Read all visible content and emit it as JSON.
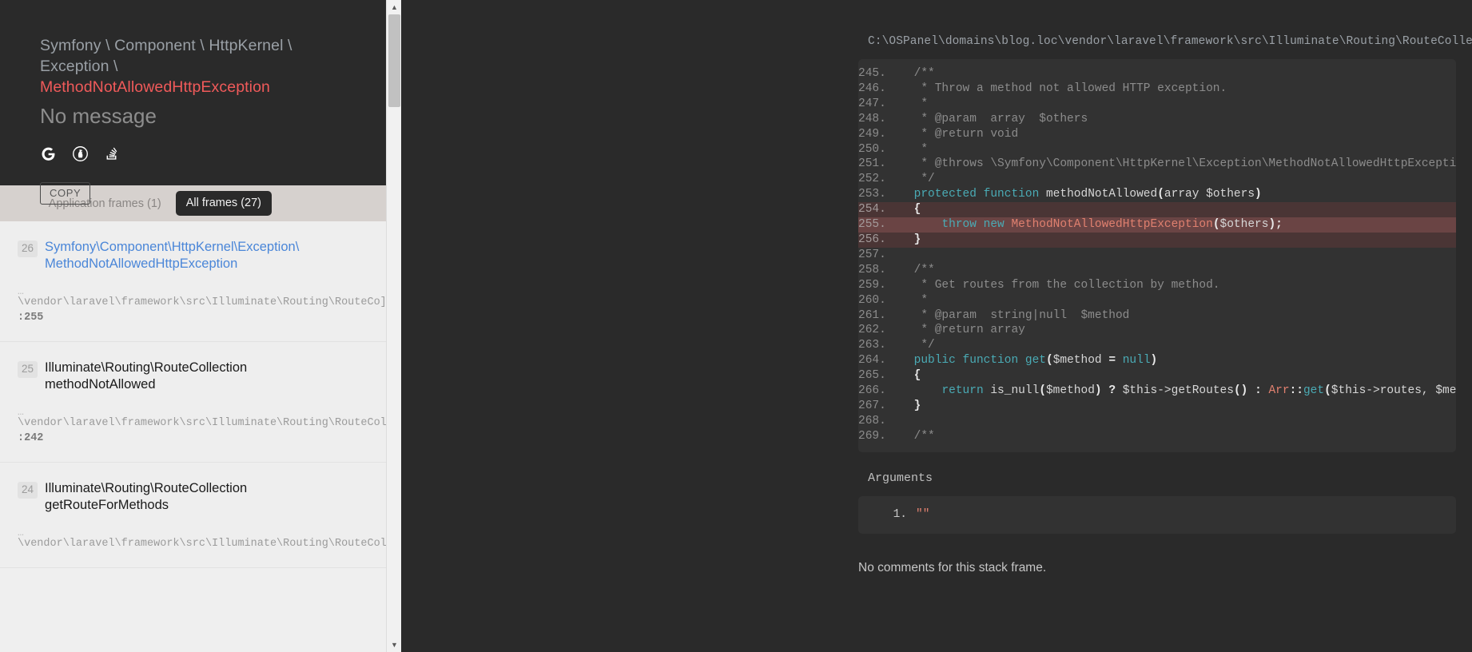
{
  "exception": {
    "namespace": "Symfony \\ Component \\ HttpKernel \\ Exception \\",
    "class_short": "MethodNotAllowedHttpException",
    "message": "No message",
    "copy_label": "COPY",
    "icons": [
      {
        "name": "google-search-icon",
        "glyph": "G"
      },
      {
        "name": "duckduckgo-search-icon",
        "glyph": "D"
      },
      {
        "name": "stackoverflow-search-icon",
        "glyph": "S"
      }
    ]
  },
  "frames_tabs": [
    {
      "label": "Application frames (1)",
      "active": false,
      "name": "tab-application-frames"
    },
    {
      "label": "All frames (27)",
      "active": true,
      "name": "tab-all-frames"
    }
  ],
  "frames": [
    {
      "number": "26",
      "class": "Symfony\\Component\\HttpKernel\\Exception\\",
      "method": "MethodNotAllowedHttpException",
      "path": "\\vendor\\laravel\\framework\\src\\Illuminate\\Routing\\RouteCo]",
      "line": ":255",
      "selected": true
    },
    {
      "number": "25",
      "class": "Illuminate\\Routing\\RouteCollection",
      "method": "methodNotAllowed",
      "path": "\\vendor\\laravel\\framework\\src\\Illuminate\\Routing\\RouteCol",
      "line": ":242",
      "selected": false
    },
    {
      "number": "24",
      "class": "Illuminate\\Routing\\RouteCollection",
      "method": "getRouteForMethods",
      "path": "\\vendor\\laravel\\framework\\src\\Illuminate\\Routing\\RouteCol",
      "line": "",
      "selected": false
    }
  ],
  "editor": {
    "file_path": "C:\\OSPanel\\domains\\blog.loc\\vendor\\laravel\\framework\\src\\Illuminate\\Routing\\RouteCollection.php",
    "lines": [
      {
        "n": "245.",
        "hl": "none",
        "tokens": [
          {
            "t": "    ",
            "c": ""
          },
          {
            "t": "/**",
            "c": "tok-com"
          }
        ]
      },
      {
        "n": "246.",
        "hl": "none",
        "tokens": [
          {
            "t": "     ",
            "c": ""
          },
          {
            "t": "* Throw a method not allowed HTTP exception.",
            "c": "tok-com"
          }
        ]
      },
      {
        "n": "247.",
        "hl": "none",
        "tokens": [
          {
            "t": "     ",
            "c": ""
          },
          {
            "t": "*",
            "c": "tok-com"
          }
        ]
      },
      {
        "n": "248.",
        "hl": "none",
        "tokens": [
          {
            "t": "     ",
            "c": ""
          },
          {
            "t": "* @param  array  $others",
            "c": "tok-com"
          }
        ]
      },
      {
        "n": "249.",
        "hl": "none",
        "tokens": [
          {
            "t": "     ",
            "c": ""
          },
          {
            "t": "* @return void",
            "c": "tok-com"
          }
        ]
      },
      {
        "n": "250.",
        "hl": "none",
        "tokens": [
          {
            "t": "     ",
            "c": ""
          },
          {
            "t": "*",
            "c": "tok-com"
          }
        ]
      },
      {
        "n": "251.",
        "hl": "none",
        "tokens": [
          {
            "t": "     ",
            "c": ""
          },
          {
            "t": "* @throws \\Symfony\\Component\\HttpKernel\\Exception\\MethodNotAllowedHttpException",
            "c": "tok-com"
          }
        ]
      },
      {
        "n": "252.",
        "hl": "none",
        "tokens": [
          {
            "t": "     ",
            "c": ""
          },
          {
            "t": "*/",
            "c": "tok-com"
          }
        ]
      },
      {
        "n": "253.",
        "hl": "none",
        "tokens": [
          {
            "t": "    ",
            "c": ""
          },
          {
            "t": "protected",
            "c": "tok-kw"
          },
          {
            "t": " ",
            "c": ""
          },
          {
            "t": "function",
            "c": "tok-kw"
          },
          {
            "t": " methodNotAllowed",
            "c": "tok-fn"
          },
          {
            "t": "(",
            "c": "tok-pct"
          },
          {
            "t": "array $others",
            "c": "tok-var"
          },
          {
            "t": ")",
            "c": "tok-pct"
          }
        ]
      },
      {
        "n": "254.",
        "hl": "soft",
        "tokens": [
          {
            "t": "    ",
            "c": ""
          },
          {
            "t": "{",
            "c": "tok-pct"
          }
        ]
      },
      {
        "n": "255.",
        "hl": "strong",
        "tokens": [
          {
            "t": "        ",
            "c": ""
          },
          {
            "t": "throw",
            "c": "tok-kw"
          },
          {
            "t": " ",
            "c": ""
          },
          {
            "t": "new",
            "c": "tok-kw"
          },
          {
            "t": " ",
            "c": ""
          },
          {
            "t": "MethodNotAllowedHttpException",
            "c": "tok-cls"
          },
          {
            "t": "(",
            "c": "tok-pct"
          },
          {
            "t": "$others",
            "c": "tok-var"
          },
          {
            "t": ")",
            "c": "tok-pct"
          },
          {
            "t": ";",
            "c": "tok-pct"
          }
        ]
      },
      {
        "n": "256.",
        "hl": "soft",
        "tokens": [
          {
            "t": "    ",
            "c": ""
          },
          {
            "t": "}",
            "c": "tok-pct"
          }
        ]
      },
      {
        "n": "257.",
        "hl": "none",
        "tokens": [
          {
            "t": "",
            "c": ""
          }
        ]
      },
      {
        "n": "258.",
        "hl": "none",
        "tokens": [
          {
            "t": "    ",
            "c": ""
          },
          {
            "t": "/**",
            "c": "tok-com"
          }
        ]
      },
      {
        "n": "259.",
        "hl": "none",
        "tokens": [
          {
            "t": "     ",
            "c": ""
          },
          {
            "t": "* Get routes from the collection by method.",
            "c": "tok-com"
          }
        ]
      },
      {
        "n": "260.",
        "hl": "none",
        "tokens": [
          {
            "t": "     ",
            "c": ""
          },
          {
            "t": "*",
            "c": "tok-com"
          }
        ]
      },
      {
        "n": "261.",
        "hl": "none",
        "tokens": [
          {
            "t": "     ",
            "c": ""
          },
          {
            "t": "* @param  string|null  $method",
            "c": "tok-com"
          }
        ]
      },
      {
        "n": "262.",
        "hl": "none",
        "tokens": [
          {
            "t": "     ",
            "c": ""
          },
          {
            "t": "* @return array",
            "c": "tok-com"
          }
        ]
      },
      {
        "n": "263.",
        "hl": "none",
        "tokens": [
          {
            "t": "     ",
            "c": ""
          },
          {
            "t": "*/",
            "c": "tok-com"
          }
        ]
      },
      {
        "n": "264.",
        "hl": "none",
        "tokens": [
          {
            "t": "    ",
            "c": ""
          },
          {
            "t": "public",
            "c": "tok-kw"
          },
          {
            "t": " ",
            "c": ""
          },
          {
            "t": "function",
            "c": "tok-kw"
          },
          {
            "t": " ",
            "c": ""
          },
          {
            "t": "get",
            "c": "tok-kw"
          },
          {
            "t": "(",
            "c": "tok-pct"
          },
          {
            "t": "$method ",
            "c": "tok-var"
          },
          {
            "t": "=",
            "c": "tok-pct"
          },
          {
            "t": " ",
            "c": ""
          },
          {
            "t": "null",
            "c": "tok-kw"
          },
          {
            "t": ")",
            "c": "tok-pct"
          }
        ]
      },
      {
        "n": "265.",
        "hl": "none",
        "tokens": [
          {
            "t": "    ",
            "c": ""
          },
          {
            "t": "{",
            "c": "tok-pct"
          }
        ]
      },
      {
        "n": "266.",
        "hl": "none",
        "tokens": [
          {
            "t": "        ",
            "c": ""
          },
          {
            "t": "return",
            "c": "tok-kw"
          },
          {
            "t": " is_null",
            "c": "tok-fn"
          },
          {
            "t": "(",
            "c": "tok-pct"
          },
          {
            "t": "$method",
            "c": "tok-var"
          },
          {
            "t": ")",
            "c": "tok-pct"
          },
          {
            "t": " ",
            "c": ""
          },
          {
            "t": "?",
            "c": "tok-pct"
          },
          {
            "t": " $this->getRoutes",
            "c": "tok-fn"
          },
          {
            "t": "()",
            "c": "tok-pct"
          },
          {
            "t": " ",
            "c": ""
          },
          {
            "t": ":",
            "c": "tok-pct"
          },
          {
            "t": " ",
            "c": ""
          },
          {
            "t": "Arr",
            "c": "tok-cls"
          },
          {
            "t": "::",
            "c": "tok-pct"
          },
          {
            "t": "get",
            "c": "tok-kw"
          },
          {
            "t": "(",
            "c": "tok-pct"
          },
          {
            "t": "$this->routes, $method, ",
            "c": "tok-var"
          },
          {
            "t": "[]",
            "c": "tok-pct"
          },
          {
            "t": ")",
            "c": "tok-pct"
          },
          {
            "t": ";",
            "c": "tok-pct"
          }
        ]
      },
      {
        "n": "267.",
        "hl": "none",
        "tokens": [
          {
            "t": "    ",
            "c": ""
          },
          {
            "t": "}",
            "c": "tok-pct"
          }
        ]
      },
      {
        "n": "268.",
        "hl": "none",
        "tokens": [
          {
            "t": "",
            "c": ""
          }
        ]
      },
      {
        "n": "269.",
        "hl": "none",
        "tokens": [
          {
            "t": "    ",
            "c": ""
          },
          {
            "t": "/**",
            "c": "tok-com"
          }
        ]
      }
    ]
  },
  "arguments": {
    "title": "Arguments",
    "items": [
      {
        "index": "1.",
        "value": "\"\""
      }
    ]
  },
  "comments": {
    "empty_text": "No comments for this stack frame."
  },
  "colors": {
    "accent_red": "#f05a5a",
    "accent_blue": "#4a86d8",
    "dark_bg": "#2a2a2a",
    "code_bg": "#323232",
    "highlight": "#6a4444"
  }
}
